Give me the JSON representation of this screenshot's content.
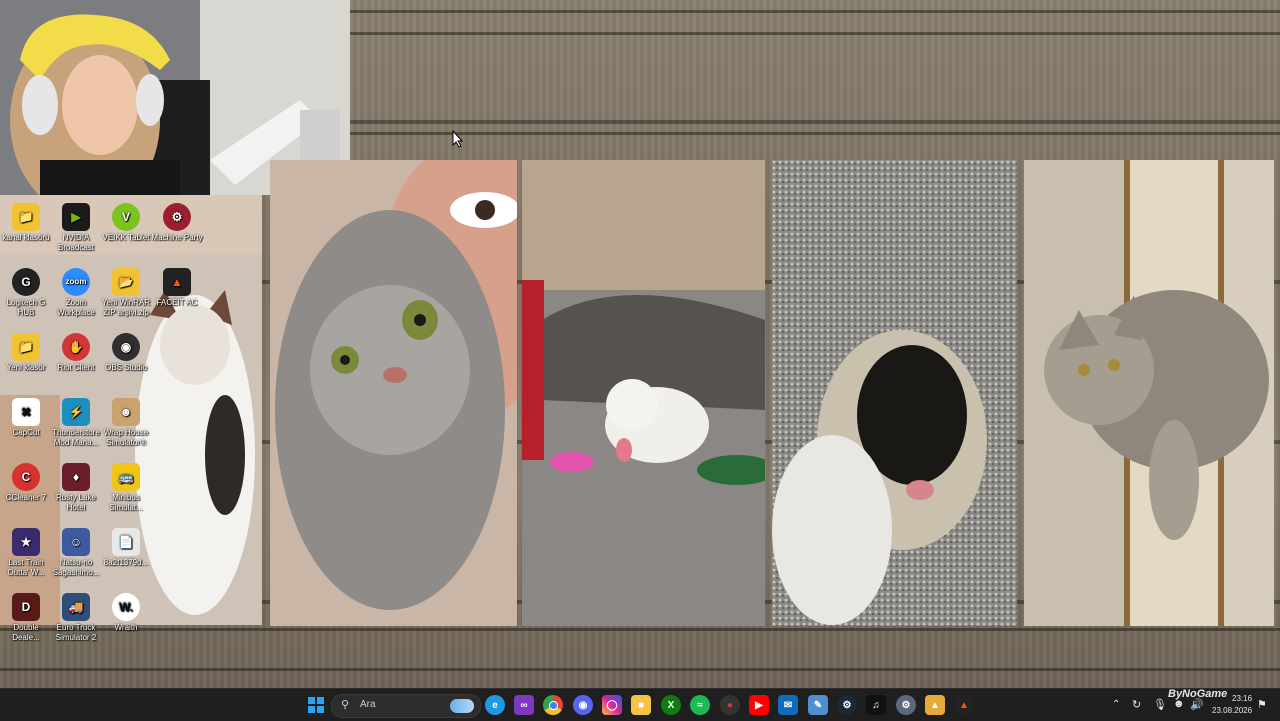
{
  "desktop": {
    "icons": [
      {
        "label": "kanal klasörü",
        "icon": "folder-icon",
        "color": "#f1c232"
      },
      {
        "label": "NVIDIA Broadcast",
        "icon": "nvidia-broadcast-icon",
        "color": "#1b1b1b"
      },
      {
        "label": "VEIKK Tablet",
        "icon": "veikk-icon",
        "color": "#7bc41f"
      },
      {
        "label": "Machine Party",
        "icon": "machine-party-icon",
        "color": "#9c1f2f"
      },
      {
        "label": "Logitech G HUB",
        "icon": "logitech-g-icon",
        "color": "#222222"
      },
      {
        "label": "Zoom Workplace",
        "icon": "zoom-icon",
        "color": "#2d8cff"
      },
      {
        "label": "Yeni WinRAR ZIP arşivi.zip",
        "icon": "folder-zip-icon",
        "color": "#f1c232"
      },
      {
        "label": "FACEIT AC",
        "icon": "faceit-icon",
        "color": "#ff5500"
      },
      {
        "label": "Yeni klasör",
        "icon": "folder-icon",
        "color": "#f1c232"
      },
      {
        "label": "Riot Client",
        "icon": "riot-client-icon",
        "color": "#d13639"
      },
      {
        "label": "OBS Studio",
        "icon": "obs-icon",
        "color": "#302e31"
      },
      {
        "label": "CapCut",
        "icon": "capcut-icon",
        "color": "#111111"
      },
      {
        "label": "Thunderstore Mod Mana...",
        "icon": "thunderstore-icon",
        "color": "#1d8fbf"
      },
      {
        "label": "Wrap House Simulator®",
        "icon": "wrap-house-icon",
        "color": "#c9a36b"
      },
      {
        "label": "CCleaner 7",
        "icon": "ccleaner-icon",
        "color": "#d8322e"
      },
      {
        "label": "Rusty Lake Hotel",
        "icon": "rusty-lake-icon",
        "color": "#6b1e2b"
      },
      {
        "label": "Minibus Simulat...",
        "icon": "minibus-icon",
        "color": "#f0c419"
      },
      {
        "label": "Last Train Outta' W...",
        "icon": "last-train-icon",
        "color": "#3a2a6e"
      },
      {
        "label": "Natsu-no Sagashimo...",
        "icon": "natsu-icon",
        "color": "#3d5a9e"
      },
      {
        "label": "8a2f1379d...",
        "icon": "file-icon",
        "color": "#e8e8e8"
      },
      {
        "label": "Double Deale...",
        "icon": "double-dealer-icon",
        "color": "#5b1a1a"
      },
      {
        "label": "Euro Truck Simulator 2",
        "icon": "euro-truck-icon",
        "color": "#2f4f7a"
      },
      {
        "label": "Wraith",
        "icon": "wraith-icon",
        "color": "#1a1a1a"
      }
    ]
  },
  "taskbar": {
    "search_label": "Ara",
    "apps": [
      {
        "icon": "windows-start-icon",
        "color": "#2aa4f4"
      },
      {
        "icon": "edge-icon",
        "color": "#1f9ae0"
      },
      {
        "icon": "visual-studio-icon",
        "color": "#7d3ac1"
      },
      {
        "icon": "chrome-icon",
        "color": "#e6453a"
      },
      {
        "icon": "discord-icon",
        "color": "#5865f2"
      },
      {
        "icon": "instagram-icon",
        "color": "#d6249f"
      },
      {
        "icon": "file-explorer-icon",
        "color": "#f6c244"
      },
      {
        "icon": "xbox-icon",
        "color": "#107c10"
      },
      {
        "icon": "spotify-icon",
        "color": "#1db954"
      },
      {
        "icon": "riot-taskbar-icon",
        "color": "#d13639"
      },
      {
        "icon": "youtube-icon",
        "color": "#ff0000"
      },
      {
        "icon": "mail-icon",
        "color": "#0f6cbd"
      },
      {
        "icon": "notepad-icon",
        "color": "#4f8ed1"
      },
      {
        "icon": "steam-icon",
        "color": "#1b2838"
      },
      {
        "icon": "tiktok-icon",
        "color": "#111111"
      },
      {
        "icon": "settings-gear-icon",
        "color": "#5a6a7c"
      },
      {
        "icon": "app-yellow-icon",
        "color": "#e8a93b"
      },
      {
        "icon": "faceit-taskbar-icon",
        "color": "#ff5500"
      }
    ],
    "tray": {
      "time": "23:16",
      "date": "23.08.2026",
      "brand": "ByNoGame"
    }
  }
}
